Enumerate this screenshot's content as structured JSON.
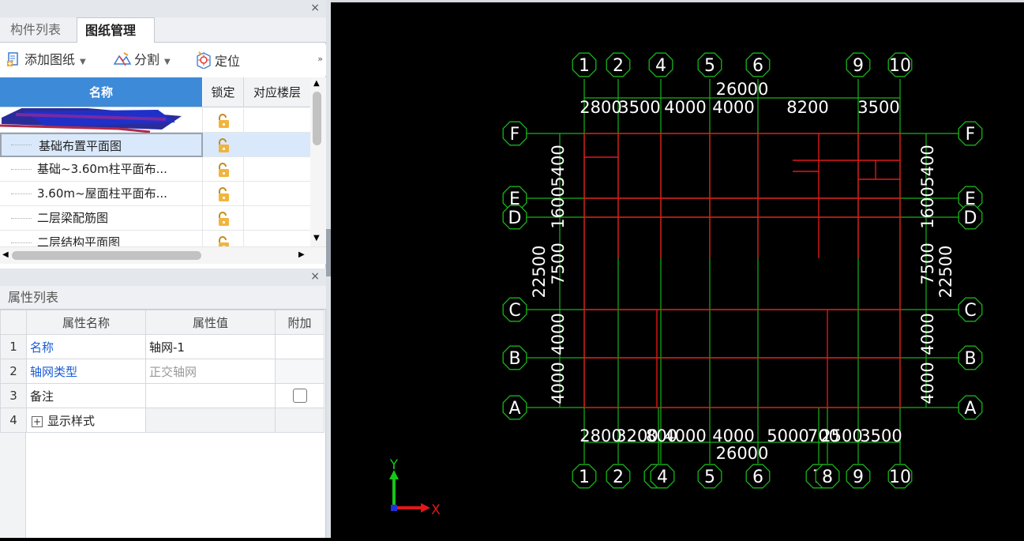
{
  "component_panel": {
    "close_label": "×",
    "tabs": [
      {
        "label": "构件列表",
        "active": false
      },
      {
        "label": "图纸管理",
        "active": true
      }
    ],
    "toolbar": {
      "add_label": "添加图纸",
      "split_label": "分割",
      "locate_label": "定位",
      "more_label": "»"
    },
    "grid": {
      "headers": {
        "name": "名称",
        "lock": "锁定",
        "floor": "对应楼层"
      },
      "rows": [
        {
          "name": "",
          "redacted": true
        },
        {
          "name": "基础布置平面图",
          "selected": true
        },
        {
          "name": "基础~3.60m柱平面布..."
        },
        {
          "name": "3.60m~屋面柱平面布..."
        },
        {
          "name": "二层梁配筋图"
        },
        {
          "name": "二层结构平面图"
        }
      ]
    }
  },
  "property_panel": {
    "close_label": "×",
    "title": "属性列表",
    "headers": {
      "name": "属性名称",
      "value": "属性值",
      "extra": "附加"
    },
    "rows": [
      {
        "num": "1",
        "name": "名称",
        "value": "轴网-1"
      },
      {
        "num": "2",
        "name": "轴网类型",
        "value": "正交轴网"
      },
      {
        "num": "3",
        "name": "备注",
        "value": ""
      },
      {
        "num": "4",
        "expander": "+",
        "name": "显示样式",
        "value": ""
      }
    ]
  },
  "drawing": {
    "top_axes": [
      "1",
      "2",
      "4",
      "5",
      "6",
      "9",
      "10"
    ],
    "bottom_axes": [
      "1",
      "2",
      "3",
      "4",
      "5",
      "6",
      "7",
      "8",
      "9",
      "10"
    ],
    "row_axes": [
      "F",
      "E",
      "D",
      "C",
      "B",
      "A"
    ],
    "top_total": "26000",
    "top_dims": [
      "2800",
      "3500",
      "4000",
      "4000",
      "8200",
      "3500"
    ],
    "bottom_total": "26000",
    "bottom_dims": [
      "2800",
      "3200",
      "800",
      "4000",
      "4000",
      "5000",
      "700",
      "2500",
      "3500"
    ],
    "left_total": "22500",
    "right_total": "22500",
    "side_dims": [
      "5400",
      "1600",
      "7500",
      "4000",
      "4000"
    ],
    "ucs_x": "X",
    "ucs_y": "Y",
    "colors": {
      "grid": "#18b418",
      "wall": "#e01818",
      "bubble_text": "#ffffff",
      "background": "#000000"
    }
  }
}
